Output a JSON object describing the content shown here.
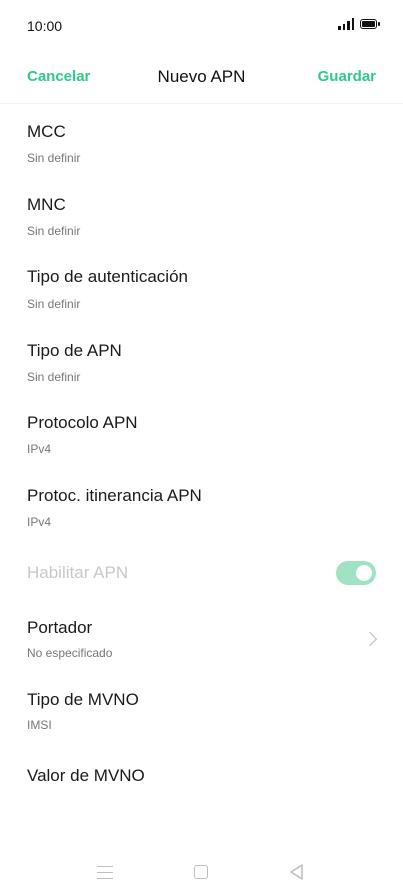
{
  "status_bar": {
    "time": "10:00"
  },
  "header": {
    "cancel_label": "Cancelar",
    "title": "Nuevo APN",
    "save_label": "Guardar"
  },
  "settings": [
    {
      "title": "MCC",
      "subtitle": "Sin definir"
    },
    {
      "title": "MNC",
      "subtitle": "Sin definir"
    },
    {
      "title": "Tipo de autenticación",
      "subtitle": "Sin definir"
    },
    {
      "title": "Tipo de APN",
      "subtitle": "Sin definir"
    },
    {
      "title": "Protocolo APN",
      "subtitle": "IPv4"
    },
    {
      "title": "Protoc. itinerancia APN",
      "subtitle": "IPv4"
    },
    {
      "title": "Habilitar APN",
      "toggle_on": true,
      "disabled": true
    },
    {
      "title": "Portador",
      "subtitle": "No especificado"
    },
    {
      "title": "Tipo de MVNO",
      "subtitle": "IMSI"
    },
    {
      "title": "Valor de MVNO"
    }
  ],
  "colors": {
    "accent": "#2fc98a",
    "toggle_track": "#9fe3c4",
    "disabled_text": "#c8c8c8"
  },
  "nav_icons": [
    "menu-icon",
    "home-icon",
    "back-icon"
  ]
}
